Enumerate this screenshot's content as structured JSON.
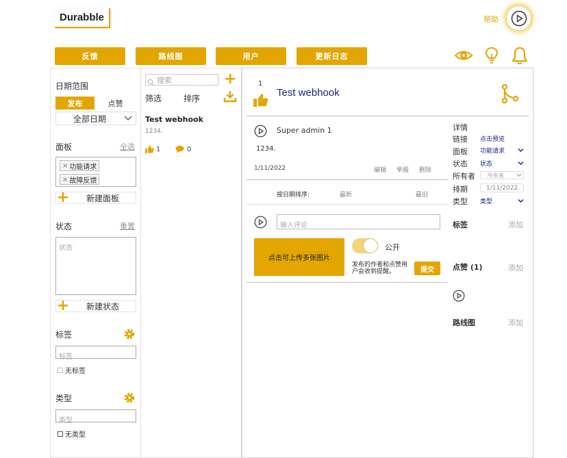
{
  "header": {
    "logo": "Durabble",
    "help": "帮助",
    "nav": [
      "反馈",
      "路线图",
      "用户",
      "更新日志"
    ]
  },
  "sidebar": {
    "date_range_label": "日期范围",
    "tabs": [
      "发布",
      "点赞"
    ],
    "date_select": "全部日期",
    "board_label": "面板",
    "select_all": "全选",
    "boards": [
      "功能请求",
      "故障反馈"
    ],
    "new_board": "新建面板",
    "status_label": "状态",
    "reset": "重置",
    "status_placeholder": "状态",
    "new_status": "新建状态",
    "tags_label": "标签",
    "tags_placeholder": "标签",
    "no_tags": "无标签",
    "type_label": "类型",
    "type_placeholder": "类型",
    "no_type": "无类型"
  },
  "list": {
    "search_placeholder": "搜索",
    "filter": "筛选",
    "sort": "排序",
    "post_title": "Test webhook",
    "post_body": "1234.",
    "likes": "1",
    "comments": "0"
  },
  "detail": {
    "vote_count": "1",
    "title": "Test webhook",
    "author": "Super admin 1",
    "body": "1234.",
    "date": "1/11/2022",
    "edit": "编辑",
    "report": "举报",
    "delete": "删除",
    "sort_by_date": "按日期排序:",
    "newest": "最新",
    "oldest": "最旧",
    "comment_placeholder": "输入评论",
    "upload": "点击可上传多张图片",
    "public": "公开",
    "notify_text": "发布的作者和点赞用户会收到提醒。",
    "submit": "提交"
  },
  "details_panel": {
    "heading": "详情",
    "link_label": "链接",
    "link_value": "点击预览",
    "board_label": "面板",
    "board_value": "功能请求",
    "status_label": "状态",
    "status_value": "状态",
    "owner_label": "所有者",
    "owner_value": "所有者",
    "eta_label": "排期",
    "eta_value": "1/11/2022",
    "type_label": "类型",
    "type_value": "类型",
    "tags_label": "标签",
    "add": "添加",
    "likes_label": "点赞 (1)",
    "roadmap_label": "路线图"
  },
  "colors": {
    "accent": "#e3a600",
    "title": "#1a237e"
  }
}
